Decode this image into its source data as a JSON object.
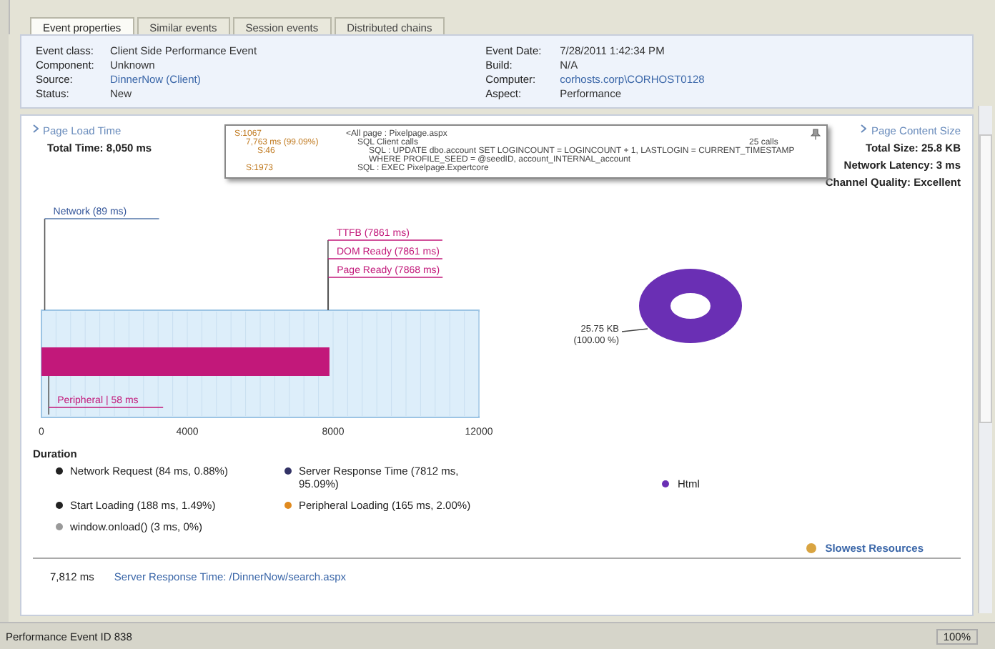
{
  "tabs": [
    {
      "label": "Event properties",
      "selected": true
    },
    {
      "label": "Similar events",
      "selected": false
    },
    {
      "label": "Session events",
      "selected": false
    },
    {
      "label": "Distributed chains",
      "selected": false
    }
  ],
  "properties_left": [
    {
      "label": "Event class:",
      "value": "Client Side Performance Event",
      "link": false
    },
    {
      "label": "Component:",
      "value": "Unknown",
      "link": false
    },
    {
      "label": "Source:",
      "value": "DinnerNow (Client)",
      "link": true
    },
    {
      "label": "Status:",
      "value": "New",
      "link": false
    }
  ],
  "properties_right": [
    {
      "label": "Event Date:",
      "value": "7/28/2011 1:42:34 PM",
      "link": false
    },
    {
      "label": "Build:",
      "value": "N/A",
      "link": false
    },
    {
      "label": "Computer:",
      "value": "corhosts.corp\\CORHOST0128",
      "link": true
    },
    {
      "label": "Aspect:",
      "value": "Performance",
      "link": false
    }
  ],
  "page_load": {
    "title": "Page Load Time",
    "total": "Total Time: 8,050 ms",
    "chart_data": {
      "type": "bar",
      "orientation": "horizontal",
      "xlim": [
        0,
        12000
      ],
      "xticks": [
        0,
        4000,
        8000,
        12000
      ],
      "series": [
        {
          "color": "#c2187a",
          "values": [
            7900
          ]
        }
      ]
    },
    "markers": [
      {
        "label": "Network (89 ms)"
      },
      {
        "label": "TTFB (7861 ms)"
      },
      {
        "label": "DOM Ready (7861 ms)"
      },
      {
        "label": "Page Ready (7868 ms)"
      },
      {
        "label": "Peripheral | 58 ms"
      }
    ]
  },
  "tooltip": {
    "rows": [
      {
        "col1": "S:1067",
        "col2": "<All page : Pixelpage.aspx",
        "children": [
          {
            "col1": "7,763 ms (99.09%)",
            "col2": "SQL Client calls",
            "col3": "25 calls",
            "children": [
              {
                "col1": "S:46",
                "col2": "SQL : UPDATE dbo.account SET LOGINCOUNT = LOGINCOUNT + 1, LASTLOGIN = CURRENT_TIMESTAMP WHERE PROFILE_SEED = @seedID, account_INTERNAL_account"
              }
            ]
          },
          {
            "col1": "S:1973",
            "col2": "SQL : EXEC Pixelpage.Expertcore"
          }
        ]
      }
    ]
  },
  "content_size": {
    "title": "Page Content Size",
    "lines": [
      "Total Size: 25.8 KB",
      "Network Latency: 3 ms",
      "Channel Quality: Excellent"
    ]
  },
  "donut": {
    "label_lines": [
      "25.75 KB",
      "(100.00 %)"
    ],
    "legend": "Html",
    "color": "#6a2fb4"
  },
  "duration": {
    "title": "Duration",
    "items": [
      {
        "label": "Network Request (84 ms, 0.88%)",
        "color": "#222222"
      },
      {
        "label": "Server Response Time (7812 ms, 95.09%)",
        "color": "#333366"
      },
      {
        "label": "Start Loading (188 ms, 1.49%)",
        "color": "#222222"
      },
      {
        "label": "Peripheral Loading (165 ms, 2.00%)",
        "color": "#e08a1e"
      },
      {
        "label": "window.onload() (3 ms, 0%)",
        "color": "#9a9a9a"
      }
    ]
  },
  "slowest_link": "Slowest Resources",
  "footer_row": {
    "time": "7,812 ms",
    "text": "Server Response Time: /DinnerNow/search.aspx"
  },
  "status_bar": {
    "text": "Performance Event ID 838",
    "zoom": "100%"
  }
}
